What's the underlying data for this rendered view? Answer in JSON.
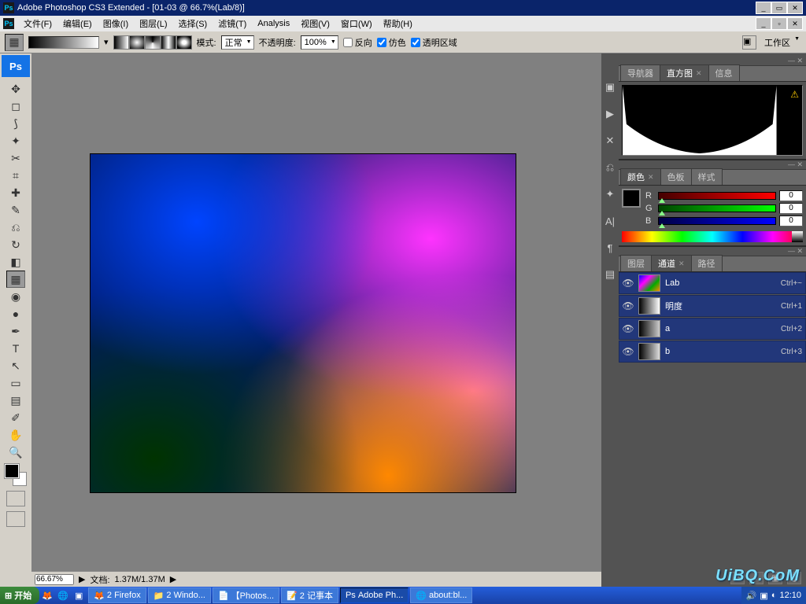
{
  "title": "Adobe Photoshop CS3 Extended - [01-03 @ 66.7%(Lab/8)]",
  "menu": {
    "file": "文件(F)",
    "edit": "编辑(E)",
    "image": "图像(I)",
    "layer": "图层(L)",
    "select": "选择(S)",
    "filter": "滤镜(T)",
    "analysis": "Analysis",
    "view": "视图(V)",
    "window": "窗口(W)",
    "help": "帮助(H)"
  },
  "options": {
    "mode_label": "模式:",
    "mode_value": "正常",
    "opacity_label": "不透明度:",
    "opacity_value": "100%",
    "reverse": "反向",
    "dither": "仿色",
    "transparency": "透明区域",
    "workspace": "工作区"
  },
  "status": {
    "zoom": "66.67%",
    "doc_label": "文档:",
    "doc_size": "1.37M/1.37M"
  },
  "panels": {
    "nav": {
      "tab1": "导航器",
      "tab2": "直方图",
      "tab3": "信息"
    },
    "color": {
      "tab1": "颜色",
      "tab2": "色板",
      "tab3": "样式",
      "r_label": "R",
      "r_val": "0",
      "g_label": "G",
      "g_val": "0",
      "b_label": "B",
      "b_val": "0"
    },
    "channels": {
      "tab1": "图层",
      "tab2": "通道",
      "tab3": "路径",
      "rows": [
        {
          "name": "Lab",
          "key": "Ctrl+~"
        },
        {
          "name": "明度",
          "key": "Ctrl+1"
        },
        {
          "name": "a",
          "key": "Ctrl+2"
        },
        {
          "name": "b",
          "key": "Ctrl+3"
        }
      ]
    }
  },
  "taskbar": {
    "start": "开始",
    "items": [
      "2 Firefox",
      "2 Windo...",
      "【Photos...",
      "2 记事本",
      "Adobe Ph...",
      "about:bl..."
    ],
    "time": "12:10"
  },
  "watermark": "UiBQ.CoM"
}
